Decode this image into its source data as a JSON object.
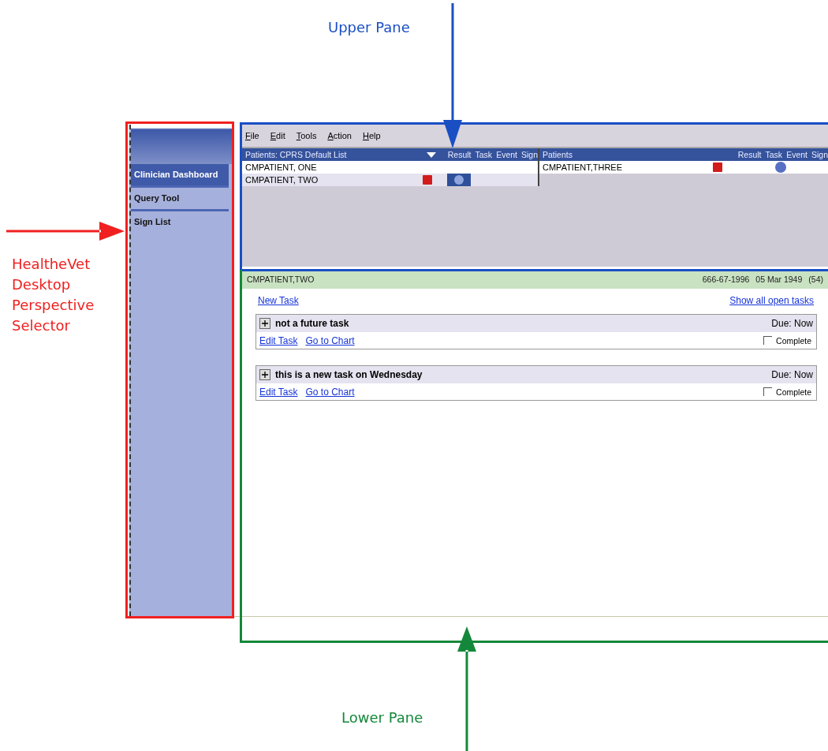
{
  "callouts": [
    {
      "kind": "upper",
      "label": "Upper Pane",
      "color": "#1a4fc4"
    },
    {
      "kind": "selector",
      "label": "HealtheVet Desktop Perspective Selector",
      "color": "#f02020"
    },
    {
      "kind": "lower",
      "label": "Lower Pane",
      "color": "#14883a"
    }
  ],
  "sidebar": {
    "items": [
      {
        "label": "Clinician Dashboard",
        "selected": true
      },
      {
        "label": "Query Tool",
        "selected": false
      },
      {
        "label": "Sign List",
        "selected": false
      }
    ]
  },
  "menu": [
    "File",
    "Edit",
    "Tools",
    "Action",
    "Help"
  ],
  "patient_lists": [
    {
      "title": "Patients: CPRS Default List",
      "dropdown": true,
      "columns": [
        "Result",
        "Task",
        "Event",
        "Sign"
      ],
      "rows": [
        {
          "name": "CMPATIENT, ONE",
          "selected": false,
          "result": false,
          "task": false,
          "event": false
        },
        {
          "name": "CMPATIENT, TWO",
          "selected": true,
          "result": true,
          "task": true,
          "event": false
        }
      ]
    },
    {
      "title": "Patients",
      "dropdown": false,
      "columns": [
        "Result",
        "Task",
        "Event",
        "Sign"
      ],
      "rows": [
        {
          "name": "CMPATIENT,THREE",
          "selected": false,
          "result": true,
          "task": false,
          "event": true
        }
      ]
    }
  ],
  "patient_bar": {
    "name": "CMPATIENT,TWO",
    "ssn": "666-67-1996",
    "dob": "05 Mar 1949",
    "age": "(54)"
  },
  "links": {
    "new_task": "New Task",
    "show_all": "Show all open tasks"
  },
  "tasks": [
    {
      "title": "not a future task",
      "due": "Due: Now",
      "links": [
        "Edit Task",
        "Go to Chart"
      ],
      "complete": {
        "label": "Complete",
        "checked": false
      }
    },
    {
      "title": "this is a new task on Wednesday",
      "due": "Due: Now",
      "links": [
        "Edit Task",
        "Go to Chart"
      ],
      "complete": {
        "label": "Complete",
        "checked": false
      }
    }
  ]
}
